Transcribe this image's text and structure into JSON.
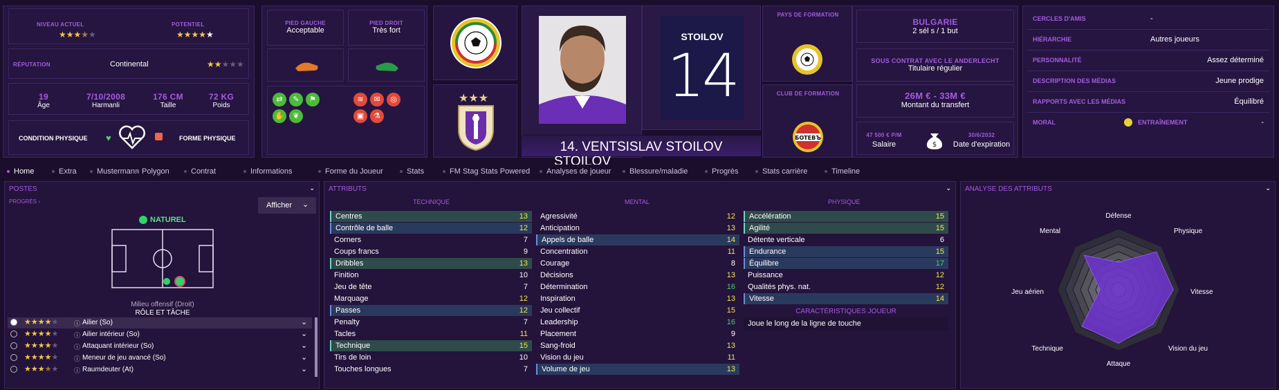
{
  "header": {
    "niveau_actuel_label": "NIVEAU ACTUEL",
    "potentiel_label": "POTENTIEL",
    "niveau_stars": 3.5,
    "potentiel_stars": 5,
    "reputation_label": "RÉPUTATION",
    "reputation_value": "Continental",
    "reputation_stars": 2,
    "age": "19",
    "age_label": "Âge",
    "dob": "7/10/2008",
    "birthplace": "Harmanli",
    "height": "176 CM",
    "height_label": "Taille",
    "weight": "72 KG",
    "weight_label": "Poids",
    "condition_label": "CONDITION PHYSIQUE",
    "forme_label": "FORME PHYSIQUE",
    "pied_gauche_label": "PIED GAUCHE",
    "pied_gauche_value": "Acceptable",
    "pied_droit_label": "PIED DROIT",
    "pied_droit_value": "Très fort",
    "jersey_name": "STOILOV",
    "jersey_number": "14",
    "player_name": "14. VENTSISLAV STOILOV",
    "pays_formation_label": "PAYS DE FORMATION",
    "club_formation_label": "CLUB DE FORMATION",
    "club_formation_badge_text": "БОТЕВЪ",
    "nation": "BULGARIE",
    "nation_caps": "2 sél s / 1 but",
    "contrat_label": "SOUS CONTRAT AVEC LE ANDERLECHT",
    "contrat_value": "Titulaire régulier",
    "transfer_value": "26M € - 33M €",
    "transfer_label": "Montant du transfert",
    "salaire_value": "47 500 € P/M",
    "salaire_label": "Salaire",
    "expiry_value": "30/6/2032",
    "expiry_label": "Date d'expiration"
  },
  "info_list": [
    {
      "k": "CERCLES D'AMIS",
      "v": "-"
    },
    {
      "k": "HIÉRARCHIE",
      "v": "Autres joueurs"
    },
    {
      "k": "PERSONNALITÉ",
      "v": "Assez déterminé"
    },
    {
      "k": "DESCRIPTION DES MÉDIAS",
      "v": "Jeune prodige"
    },
    {
      "k": "RAPPORTS AVEC LES MÉDIAS",
      "v": "Équilibré"
    },
    {
      "k": "MORAL",
      "v": ""
    },
    {
      "k": "ENTRAÎNEMENT",
      "v": "-"
    }
  ],
  "tabs": [
    "Home",
    "Extra",
    "Mustermann",
    "Polygon",
    "Contrat",
    "Informations",
    "Forme du Joueur",
    "Stats",
    "FM Stag Stats Powered",
    "Analyses de joueur",
    "Blessure/maladie",
    "Progrès",
    "Stats carrière",
    "Timeline"
  ],
  "postes": {
    "title": "POSTES",
    "progres": "PROGRÈS ›",
    "afficher": "Afficher",
    "naturel": "NATUREL",
    "position": "Milieu offensif (Droit)",
    "role_title": "RÔLE ET TÂCHE",
    "roles": [
      {
        "stars": 4,
        "name": "Ailier (So)"
      },
      {
        "stars": 4,
        "name": "Ailier intérieur (So)"
      },
      {
        "stars": 4,
        "name": "Attaquant intérieur (So)"
      },
      {
        "stars": 4,
        "name": "Meneur de jeu avancé (So)"
      },
      {
        "stars": 3.5,
        "name": "Raumdeuter (At)"
      }
    ]
  },
  "attributs": {
    "title": "ATTRIBUTS",
    "technique_label": "TECHNIQUE",
    "mental_label": "MENTAL",
    "physique_label": "PHYSIQUE",
    "technique": [
      [
        "Centres",
        "13"
      ],
      [
        "Contrôle de balle",
        "12"
      ],
      [
        "Corners",
        "7"
      ],
      [
        "Coups francs",
        "9"
      ],
      [
        "Dribbles",
        "13"
      ],
      [
        "Finition",
        "10"
      ],
      [
        "Jeu de tête",
        "7"
      ],
      [
        "Marquage",
        "12"
      ],
      [
        "Passes",
        "12"
      ],
      [
        "Penalty",
        "7"
      ],
      [
        "Tacles",
        "11"
      ],
      [
        "Technique",
        "15"
      ],
      [
        "Tirs de loin",
        "10"
      ],
      [
        "Touches longues",
        "7"
      ]
    ],
    "mental": [
      [
        "Agressivité",
        "12"
      ],
      [
        "Anticipation",
        "13"
      ],
      [
        "Appels de balle",
        "14"
      ],
      [
        "Concentration",
        "11"
      ],
      [
        "Courage",
        "8"
      ],
      [
        "Décisions",
        "13"
      ],
      [
        "Détermination",
        "16"
      ],
      [
        "Inspiration",
        "13"
      ],
      [
        "Jeu collectif",
        "15"
      ],
      [
        "Leadership",
        "16"
      ],
      [
        "Placement",
        "9"
      ],
      [
        "Sang-froid",
        "13"
      ],
      [
        "Vision du jeu",
        "11"
      ],
      [
        "Volume de jeu",
        "13"
      ]
    ],
    "physique": [
      [
        "Accélération",
        "15"
      ],
      [
        "Agilité",
        "15"
      ],
      [
        "Détente verticale",
        "6"
      ],
      [
        "Endurance",
        "15"
      ],
      [
        "Équilibre",
        "17"
      ],
      [
        "Puissance",
        "12"
      ],
      [
        "Qualités phys. nat.",
        "12"
      ],
      [
        "Vitesse",
        "14"
      ]
    ],
    "carac_label": "CARACTÉRISTIQUES JOUEUR",
    "carac_value": "Joue le long de la ligne de touche"
  },
  "analyse": {
    "title": "ANALYSE DES ATTRIBUTS",
    "labels": [
      "Défense",
      "Physique",
      "Vitesse",
      "Vision du jeu",
      "Attaque",
      "Technique",
      "Jeu aérien",
      "Mental"
    ]
  },
  "colors": {
    "accent": "#a35ce0",
    "bg": "#1b0d2c",
    "panel": "#24133b"
  }
}
